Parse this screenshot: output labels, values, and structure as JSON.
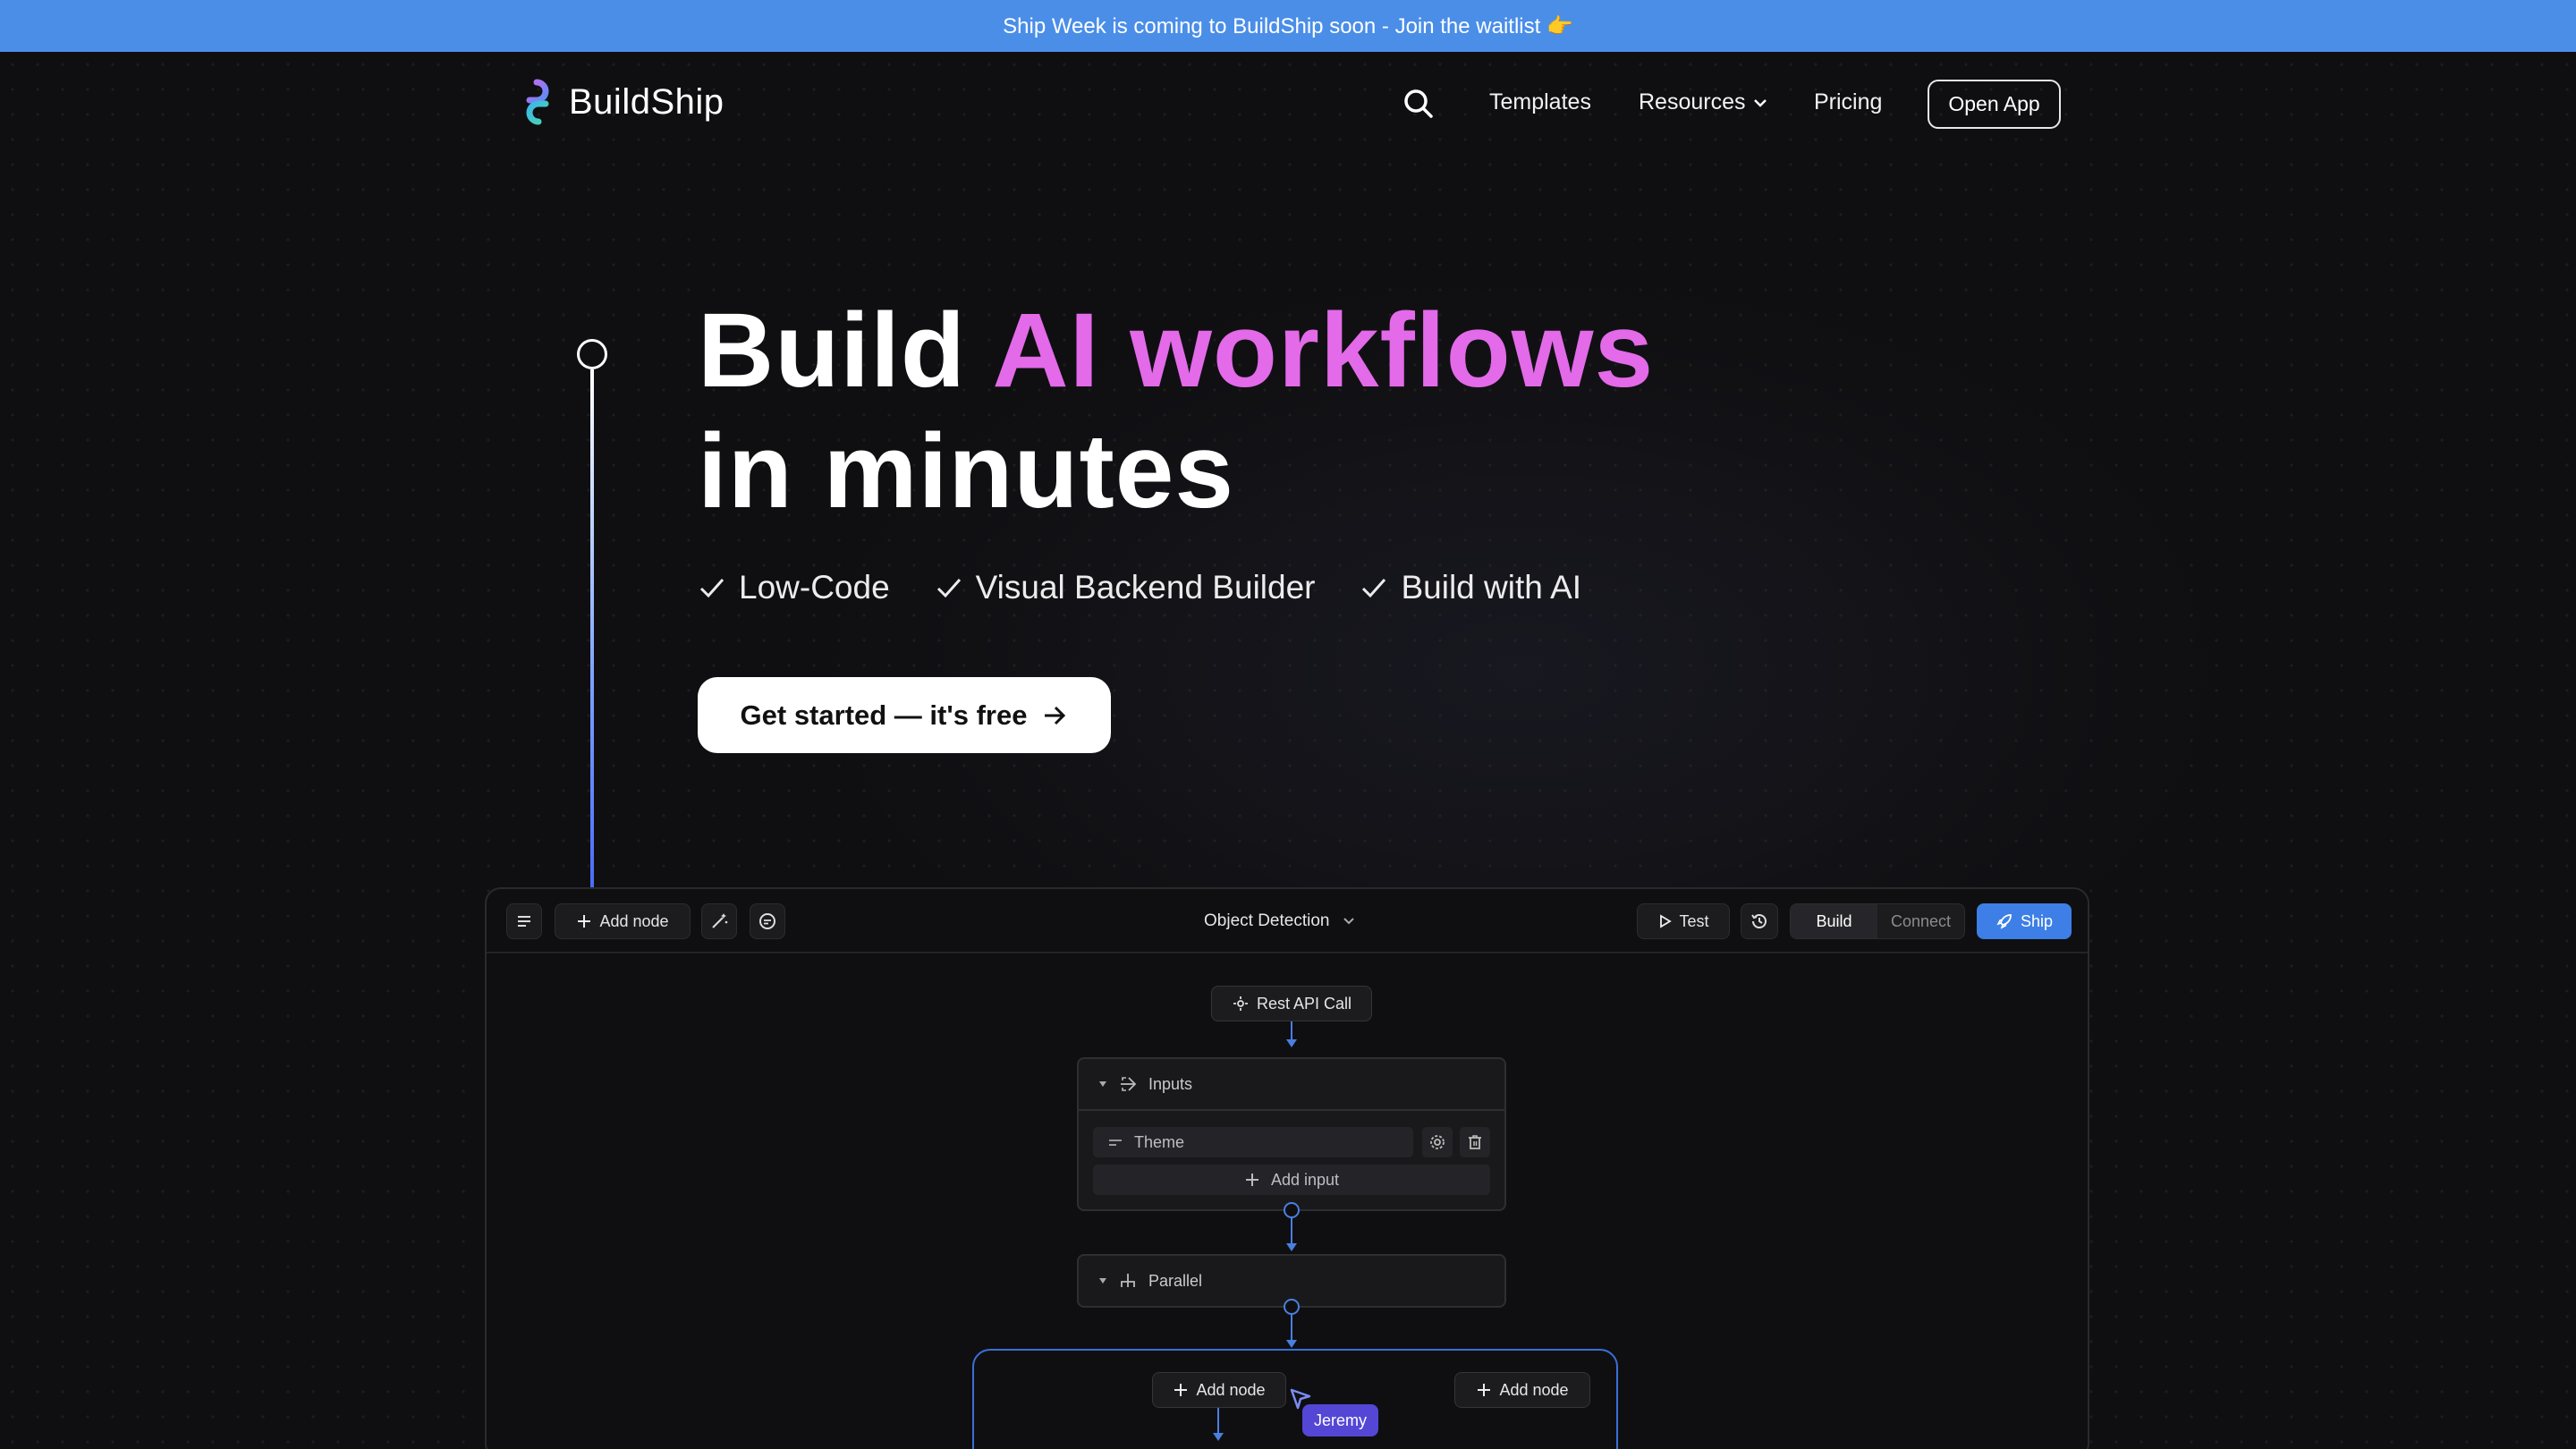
{
  "banner": {
    "text": "Ship Week is coming to BuildShip soon - Join the waitlist 👉"
  },
  "nav": {
    "logo_text": "BuildShip",
    "links": {
      "templates": "Templates",
      "resources": "Resources",
      "pricing": "Pricing"
    },
    "open_app": "Open App"
  },
  "hero": {
    "title_part1": "Build",
    "title_accent": "AI workflows",
    "title_line2": "in minutes",
    "features": [
      "Low-Code",
      "Visual Backend Builder",
      "Build with AI"
    ],
    "cta": "Get started — it's free"
  },
  "editor": {
    "toolbar": {
      "add_node": "Add node",
      "workflow_name": "Object Detection",
      "test": "Test",
      "build": "Build",
      "connect": "Connect",
      "ship": "Ship"
    },
    "trigger": "Rest API Call",
    "inputs_card": {
      "title": "Inputs",
      "field": "Theme",
      "add_input": "Add input"
    },
    "parallel_card": {
      "title": "Parallel"
    },
    "branch_add_left": "Add node",
    "branch_add_right": "Add node",
    "cursor_user": "Jeremy"
  },
  "colors": {
    "banner": "#4a8ee8",
    "accent": "#e36ae8",
    "ship": "#3d7fe6",
    "cursor_label": "#5447d6",
    "connector": "#4a7fe0"
  }
}
